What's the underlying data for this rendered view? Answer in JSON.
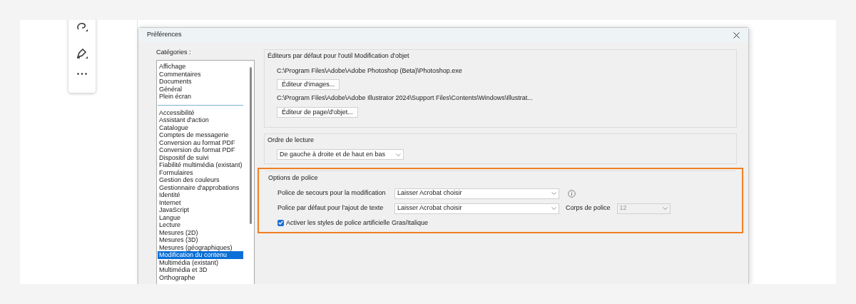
{
  "window": {
    "title": "Préférences"
  },
  "categories": {
    "label": "Catégories :",
    "groups": [
      [
        {
          "label": "Affichage",
          "selected": false
        },
        {
          "label": "Commentaires",
          "selected": false
        },
        {
          "label": "Documents",
          "selected": false
        },
        {
          "label": "Général",
          "selected": false
        },
        {
          "label": "Plein écran",
          "selected": false
        }
      ],
      [
        {
          "label": "Accessibilité",
          "selected": false
        },
        {
          "label": "Assistant d'action",
          "selected": false
        },
        {
          "label": "Catalogue",
          "selected": false
        },
        {
          "label": "Comptes de messagerie",
          "selected": false
        },
        {
          "label": "Conversion au format PDF",
          "selected": false
        },
        {
          "label": "Conversion du format PDF",
          "selected": false
        },
        {
          "label": "Dispositif de suivi",
          "selected": false
        },
        {
          "label": "Fiabilité multimédia (existant)",
          "selected": false
        },
        {
          "label": "Formulaires",
          "selected": false
        },
        {
          "label": "Gestion des couleurs",
          "selected": false
        },
        {
          "label": "Gestionnaire d'approbations",
          "selected": false
        },
        {
          "label": "Identité",
          "selected": false
        },
        {
          "label": "Internet",
          "selected": false
        },
        {
          "label": "JavaScript",
          "selected": false
        },
        {
          "label": "Langue",
          "selected": false
        },
        {
          "label": "Lecture",
          "selected": false
        },
        {
          "label": "Mesures (2D)",
          "selected": false
        },
        {
          "label": "Mesures (3D)",
          "selected": false
        },
        {
          "label": "Mesures (géographiques)",
          "selected": false
        },
        {
          "label": "Modification du contenu",
          "selected": true
        },
        {
          "label": "Multimédia (existant)",
          "selected": false
        },
        {
          "label": "Multimédia et 3D",
          "selected": false
        },
        {
          "label": "Orthographe",
          "selected": false
        }
      ]
    ]
  },
  "editors": {
    "title": "Éditeurs par défaut pour l'outil Modification d'objet",
    "items": [
      {
        "path": "C:\\Program Files\\Adobe\\Adobe Photoshop (Beta)\\Photoshop.exe",
        "button": "Éditeur d'images..."
      },
      {
        "path": "C:\\Program Files\\Adobe\\Adobe Illustrator 2024\\Support Files\\Contents\\Windows\\Illustrat...",
        "button": "Éditeur de page/d'objet..."
      }
    ]
  },
  "reading_order": {
    "title": "Ordre de lecture",
    "value": "De gauche à droite et de haut en bas"
  },
  "font_options": {
    "title": "Options de police",
    "highlighted": true,
    "fallback": {
      "label": "Police de secours pour la modification",
      "value": "Laisser Acrobat choisir"
    },
    "default_font": {
      "label": "Police par défaut pour l'ajout de texte",
      "value": "Laisser Acrobat choisir"
    },
    "size": {
      "label": "Corps de police",
      "value": "12",
      "disabled": true
    },
    "synthetic": {
      "label": "Activer les styles de police artificielle Gras/Italique",
      "checked": true
    }
  }
}
